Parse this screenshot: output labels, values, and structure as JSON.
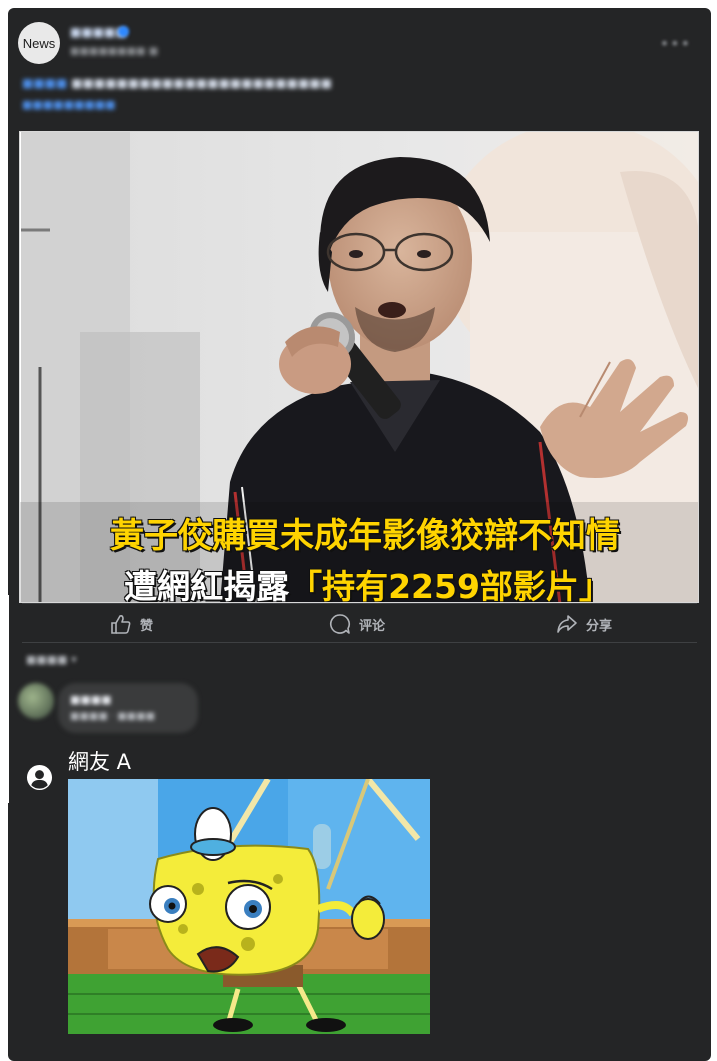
{
  "post": {
    "avatar_text": "News",
    "page_name": "■■■■■",
    "time": "■■■■■■■■ ■",
    "more": "•••",
    "caption_line1_prefix": "■■■■",
    "caption_line1": "■■■■■■■■■■■■■■■■■■■■■■■",
    "caption_line2": "■■■■■■■■■"
  },
  "news_photo": {
    "headline_line1": "黃子佼購買未成年影像狡辯不知情",
    "headline_line2_white": "遭網紅揭露",
    "headline_line2_yellow": "「持有2259部影片」"
  },
  "actions": {
    "like": "赞",
    "comment": "评论",
    "share": "分享"
  },
  "comments_sort": "■■■■ ▾",
  "blurred_comment": {
    "name": "■■■■",
    "text": "■■■■ · ■■■■"
  },
  "user_comment": {
    "author": "網友 A"
  },
  "colors": {
    "card_bg": "#242526",
    "headline_yellow": "#ffd400",
    "link_blue": "#4d8ee8",
    "action_gray": "#b0b3b8"
  }
}
